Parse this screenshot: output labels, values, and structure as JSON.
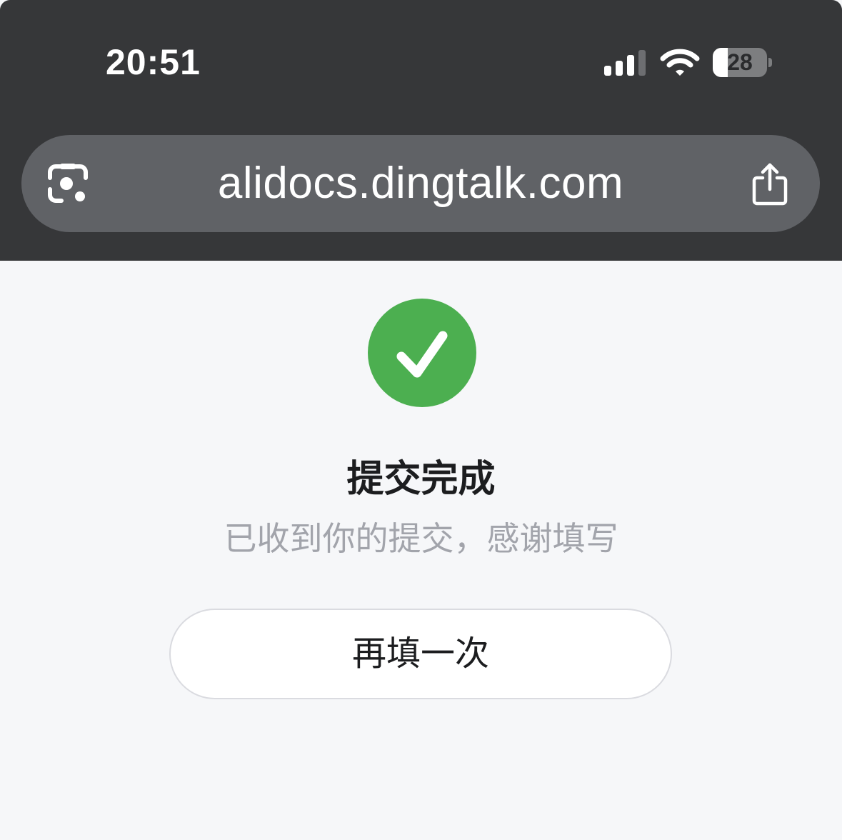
{
  "status_bar": {
    "time": "20:51",
    "battery_level": "28",
    "icons": [
      "cellular-signal-icon",
      "wifi-icon",
      "battery-icon"
    ]
  },
  "browser": {
    "url": "alidocs.dingtalk.com",
    "icons": [
      "google-lens-icon",
      "share-icon"
    ]
  },
  "result": {
    "icon": "check-circle-icon",
    "title": "提交完成",
    "message": "已收到你的提交，感谢填写",
    "refill_label": "再填一次"
  },
  "colors": {
    "chrome_background": "#363739",
    "url_bar_background": "#606266",
    "page_background": "#f6f7f9",
    "success_green": "#4caf50",
    "subtitle_gray": "#a2a4ab"
  }
}
